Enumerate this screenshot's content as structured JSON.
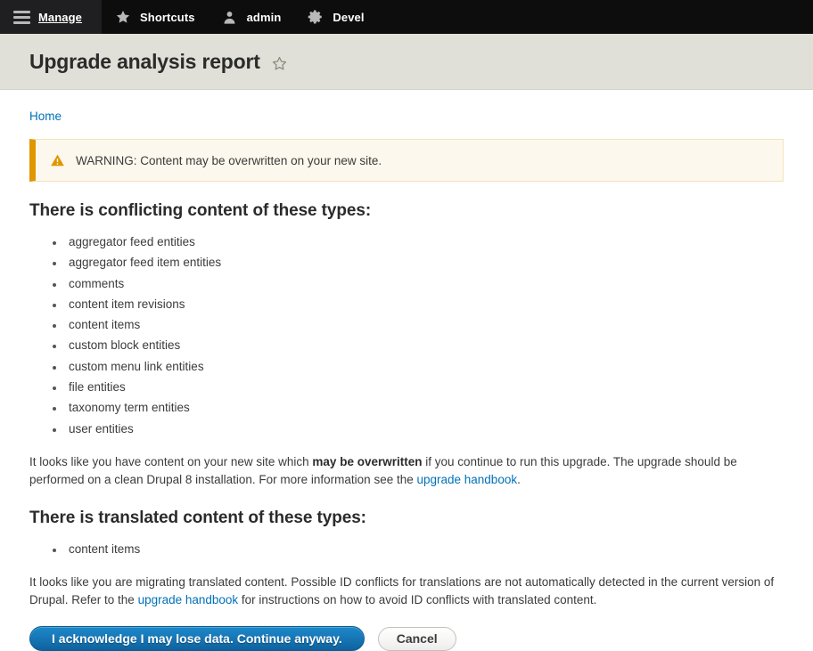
{
  "toolbar": {
    "tabs": [
      {
        "label": "Manage",
        "icon": "hamburger-icon",
        "active": true
      },
      {
        "label": "Shortcuts",
        "icon": "star-filled-icon",
        "active": false
      },
      {
        "label": "admin",
        "icon": "user-icon",
        "active": false
      },
      {
        "label": "Devel",
        "icon": "gear-icon",
        "active": false
      }
    ]
  },
  "header": {
    "title": "Upgrade analysis report",
    "favorite_icon": "star-outline-icon"
  },
  "breadcrumb": {
    "items": [
      {
        "label": "Home"
      }
    ]
  },
  "warning": {
    "icon": "warning-triangle-icon",
    "message": "WARNING: Content may be overwritten on your new site.",
    "accent_color": "#e09600",
    "background_color": "#fdf8ed"
  },
  "sections": [
    {
      "heading": "There is conflicting content of these types:",
      "items": [
        "aggregator feed entities",
        "aggregator feed item entities",
        "comments",
        "content item revisions",
        "content items",
        "custom block entities",
        "custom menu link entities",
        "file entities",
        "taxonomy term entities",
        "user entities"
      ],
      "paragraph": {
        "part1": "It looks like you have content on your new site which ",
        "bold": "may be overwritten",
        "part2": " if you continue to run this upgrade. The upgrade should be performed on a clean Drupal 8 installation. For more information see the ",
        "link": "upgrade handbook",
        "part3": "."
      }
    },
    {
      "heading": "There is translated content of these types:",
      "items": [
        "content items"
      ],
      "paragraph": {
        "part1": "It looks like you are migrating translated content. Possible ID conflicts for translations are not automatically detected in the current version of Drupal. Refer to the ",
        "bold": "",
        "part2": "",
        "link": "upgrade handbook",
        "part3": " for instructions on how to avoid ID conflicts with translated content."
      }
    }
  ],
  "actions": {
    "primary_label": "I acknowledge I may lose data. Continue anyway.",
    "secondary_label": "Cancel",
    "primary_color": "#1878b8"
  }
}
